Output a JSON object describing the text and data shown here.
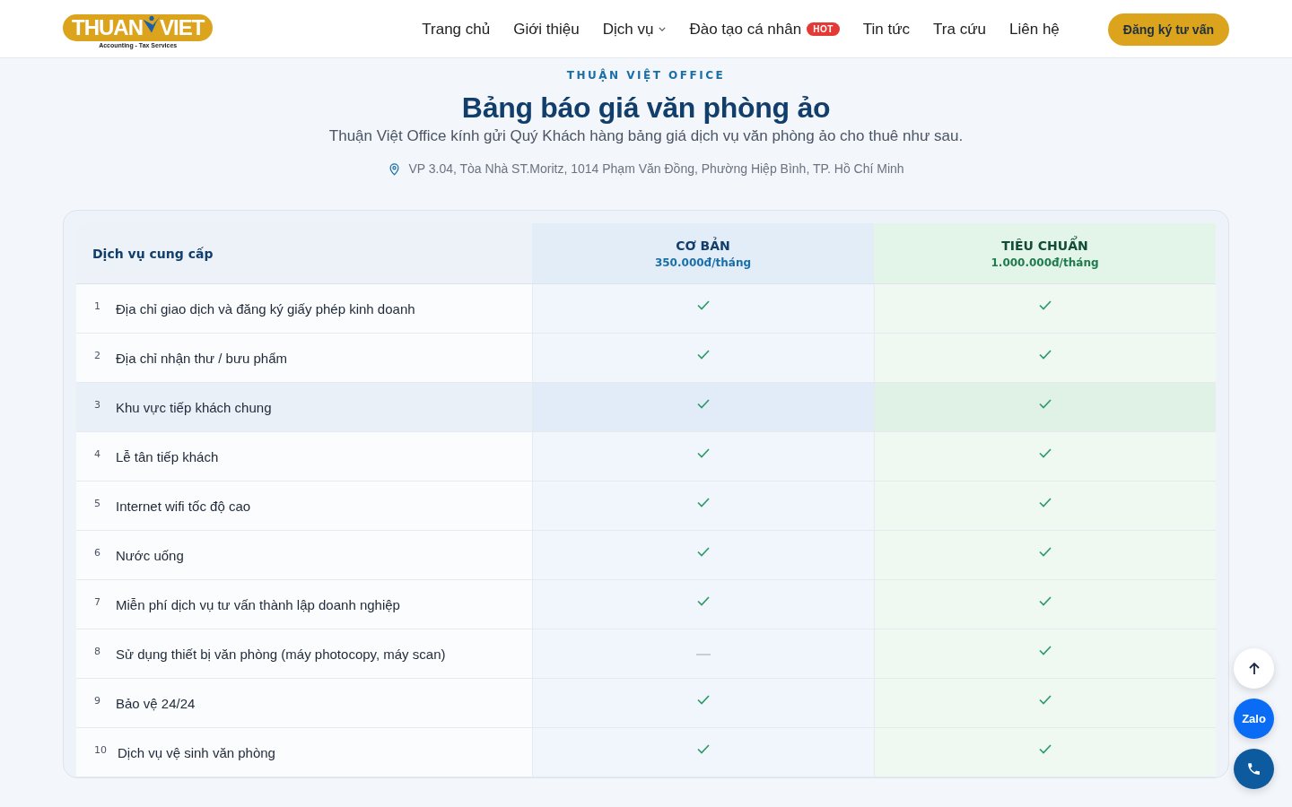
{
  "header": {
    "logo": {
      "brand_left": "THUAN",
      "brand_right": "VIET",
      "tagline": "Accounting - Tax Services"
    },
    "nav": [
      {
        "label": "Trang chủ",
        "dropdown": false
      },
      {
        "label": "Giới thiệu",
        "dropdown": false
      },
      {
        "label": "Dịch vụ",
        "dropdown": true
      },
      {
        "label": "Đào tạo cá nhân",
        "dropdown": false,
        "badge": "HOT"
      },
      {
        "label": "Tin tức",
        "dropdown": false
      },
      {
        "label": "Tra cứu",
        "dropdown": false
      },
      {
        "label": "Liên hệ",
        "dropdown": false
      }
    ],
    "cta": "Đăng ký tư vấn"
  },
  "hero": {
    "eyebrow": "THUẬN VIỆT OFFICE",
    "title": "Bảng báo giá văn phòng ảo",
    "subtitle": "Thuận Việt Office kính gửi Quý Khách hàng bảng giá dịch vụ văn phòng ảo cho thuê như sau.",
    "address": "VP 3.04, Tòa Nhà ST.Moritz, 1014 Phạm Văn Đồng, Phường Hiệp Bình, TP. Hồ Chí Minh"
  },
  "table": {
    "first_column": "Dịch vụ cung cấp",
    "plans": [
      {
        "name": "CƠ BẢN",
        "price": "350.000đ/tháng"
      },
      {
        "name": "TIÊU CHUẨN",
        "price": "1.000.000đ/tháng"
      }
    ],
    "rows": [
      {
        "number": "1",
        "service": "Địa chỉ giao dịch và đăng ký giấy phép kinh doanh",
        "highlighted": false,
        "included": [
          true,
          true
        ]
      },
      {
        "number": "2",
        "service": "Địa chỉ nhận thư / bưu phẩm",
        "highlighted": false,
        "included": [
          true,
          true
        ]
      },
      {
        "number": "3",
        "service": "Khu vực tiếp khách chung",
        "highlighted": true,
        "included": [
          true,
          true
        ]
      },
      {
        "number": "4",
        "service": "Lễ tân tiếp khách",
        "highlighted": false,
        "included": [
          true,
          true
        ]
      },
      {
        "number": "5",
        "service": "Internet wifi tốc độ cao",
        "highlighted": false,
        "included": [
          true,
          true
        ]
      },
      {
        "number": "6",
        "service": "Nước uống",
        "highlighted": false,
        "included": [
          true,
          true
        ]
      },
      {
        "number": "7",
        "service": "Miễn phí dịch vụ tư vấn thành lập doanh nghiệp",
        "highlighted": false,
        "included": [
          true,
          true
        ]
      },
      {
        "number": "8",
        "service": "Sử dụng thiết bị văn phòng (máy photocopy, máy scan)",
        "highlighted": false,
        "included": [
          false,
          true
        ]
      },
      {
        "number": "9",
        "service": "Bảo vệ 24/24",
        "highlighted": false,
        "included": [
          true,
          true
        ]
      },
      {
        "number": "10",
        "service": "Dịch vụ vệ sinh văn phòng",
        "highlighted": false,
        "included": [
          true,
          true
        ]
      }
    ]
  },
  "floating": {
    "zalo": "Zalo"
  }
}
